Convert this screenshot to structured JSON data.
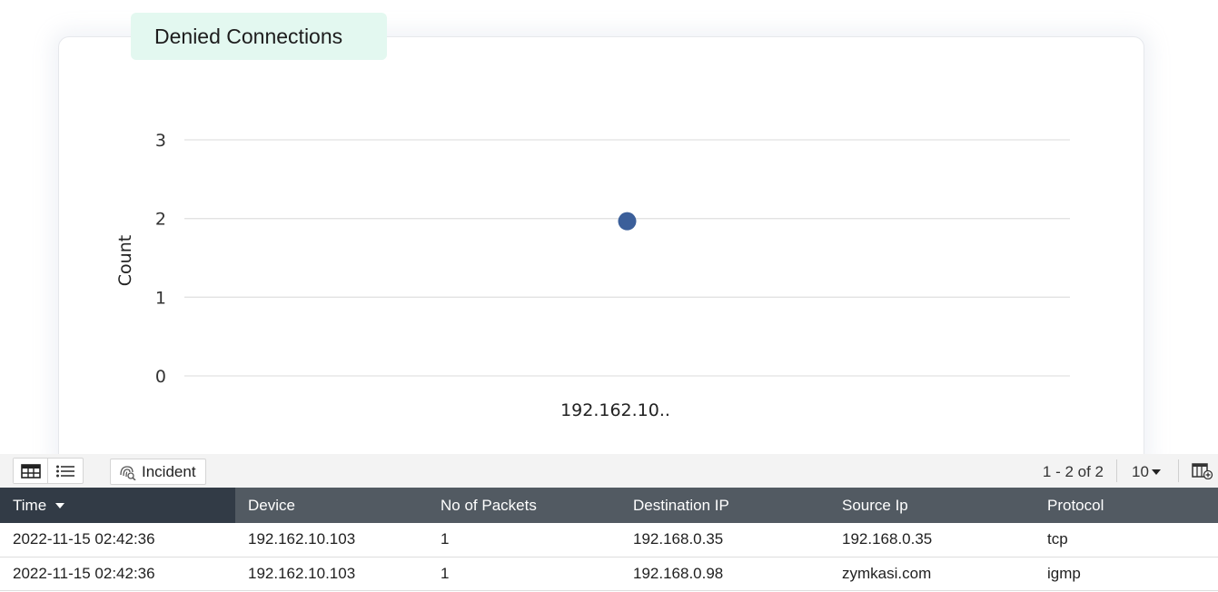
{
  "widget": {
    "title": "Denied Connections"
  },
  "chart_data": {
    "type": "scatter",
    "title": "Denied Connections",
    "xlabel": "",
    "ylabel": "Count",
    "categories": [
      "192.162.10.."
    ],
    "values": [
      2
    ],
    "yticks": [
      0,
      1,
      2,
      3
    ],
    "ylim": [
      0,
      3
    ],
    "grid": true,
    "point_color": "#3b5f9a"
  },
  "toolbar": {
    "grid_view_icon": "table-grid-icon",
    "list_view_icon": "list-icon",
    "incident_label": "Incident",
    "incident_icon": "fingerprint-search-icon",
    "pagination": "1 - 2 of 2",
    "page_size": "10",
    "column_chooser_icon": "column-settings-icon"
  },
  "table": {
    "columns": [
      "Time",
      "Device",
      "No of Packets",
      "Destination IP",
      "Source Ip",
      "Protocol"
    ],
    "sorted_column": "Time",
    "rows": [
      [
        "2022-11-15 02:42:36",
        "192.162.10.103",
        "1",
        "192.168.0.35",
        "192.168.0.35",
        "tcp"
      ],
      [
        "2022-11-15 02:42:36",
        "192.162.10.103",
        "1",
        "192.168.0.98",
        "zymkasi.com",
        "igmp"
      ]
    ]
  }
}
